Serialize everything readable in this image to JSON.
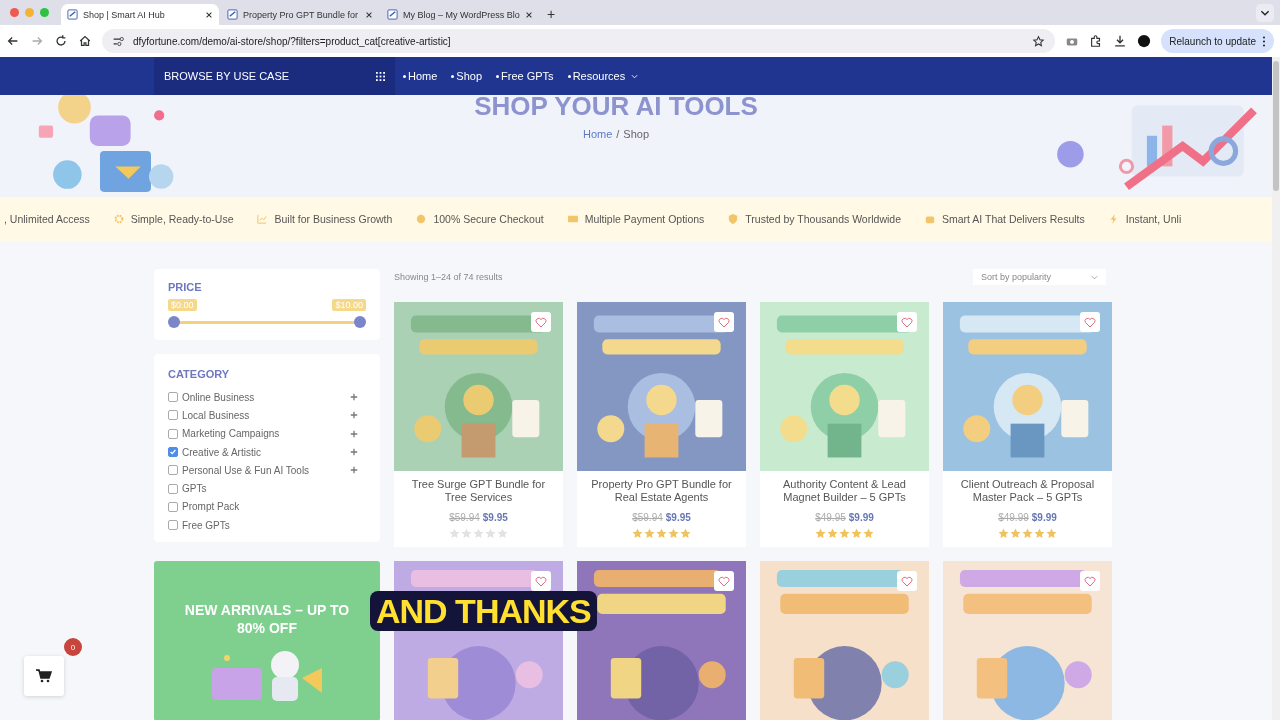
{
  "browser": {
    "tabs": [
      {
        "title": "Shop | Smart AI Hub",
        "selected": true
      },
      {
        "title": "Property Pro GPT Bundle for",
        "selected": false
      },
      {
        "title": "My Blog – My WordPress Blo",
        "selected": false
      }
    ],
    "new_tab": "+",
    "url": "dfyfortune.com/demo/ai-store/shop/?filters=product_cat[creative-artistic]",
    "relaunch": "Relaunch to update"
  },
  "nav": {
    "browse": "BROWSE BY USE CASE",
    "items": [
      {
        "label": "Home",
        "dropdown": false
      },
      {
        "label": "Shop",
        "dropdown": false
      },
      {
        "label": "Free GPTs",
        "dropdown": false
      },
      {
        "label": "Resources",
        "dropdown": true
      }
    ]
  },
  "hero": {
    "title": "SHOP YOUR AI TOOLS",
    "breadcrumb": {
      "home": "Home",
      "separator": "/",
      "current": "Shop"
    }
  },
  "ticker": [
    {
      "label": ", Unlimited Access"
    },
    {
      "label": "Simple, Ready-to-Use"
    },
    {
      "label": "Built for Business Growth"
    },
    {
      "label": "100% Secure Checkout"
    },
    {
      "label": "Multiple Payment Options"
    },
    {
      "label": "Trusted by Thousands Worldwide"
    },
    {
      "label": "Smart AI That Delivers Results"
    },
    {
      "label": "Instant, Unli"
    }
  ],
  "price_filter": {
    "title": "PRICE",
    "min": "$0.00",
    "max": "$10.00",
    "level": 1
  },
  "category_filter": {
    "title": "CATEGORY",
    "items": [
      {
        "label": "Online Business",
        "checked": false,
        "expandable": true
      },
      {
        "label": "Local Business",
        "checked": false,
        "expandable": true
      },
      {
        "label": "Marketing Campaigns",
        "checked": false,
        "expandable": true
      },
      {
        "label": "Creative & Artistic",
        "checked": true,
        "expandable": true
      },
      {
        "label": "Personal Use & Fun AI Tools",
        "checked": false,
        "expandable": true
      },
      {
        "label": "GPTs",
        "checked": false,
        "expandable": false
      },
      {
        "label": "Prompt Pack",
        "checked": false,
        "expandable": false
      },
      {
        "label": "Free GPTs",
        "checked": false,
        "expandable": false
      }
    ]
  },
  "results": "Showing 1–24 of 74 results",
  "sort": "Sort by popularity",
  "products": [
    {
      "title": "Tree Surge GPT Bundle for Tree Services",
      "old_price": "$59.94",
      "price": "$9.95",
      "stars": 0
    },
    {
      "title": "Property Pro GPT Bundle for Real Estate Agents",
      "old_price": "$59.94",
      "price": "$9.95",
      "stars": 5
    },
    {
      "title": "Authority Content & Lead Magnet Builder – 5 GPTs",
      "old_price": "$49.95",
      "price": "$9.99",
      "stars": 5
    },
    {
      "title": "Client Outreach & Proposal Master Pack – 5 GPTs",
      "old_price": "$49.99",
      "price": "$9.99",
      "stars": 5
    }
  ],
  "second_row": [
    {
      "kind": "promo",
      "title": "NEW ARRIVALS – UP TO 80% OFF"
    },
    {
      "kind": "picture"
    },
    {
      "kind": "picture"
    },
    {
      "kind": "picture"
    },
    {
      "kind": "picture"
    }
  ],
  "cart": {
    "count": "0"
  },
  "caption": "AND THANKS"
}
